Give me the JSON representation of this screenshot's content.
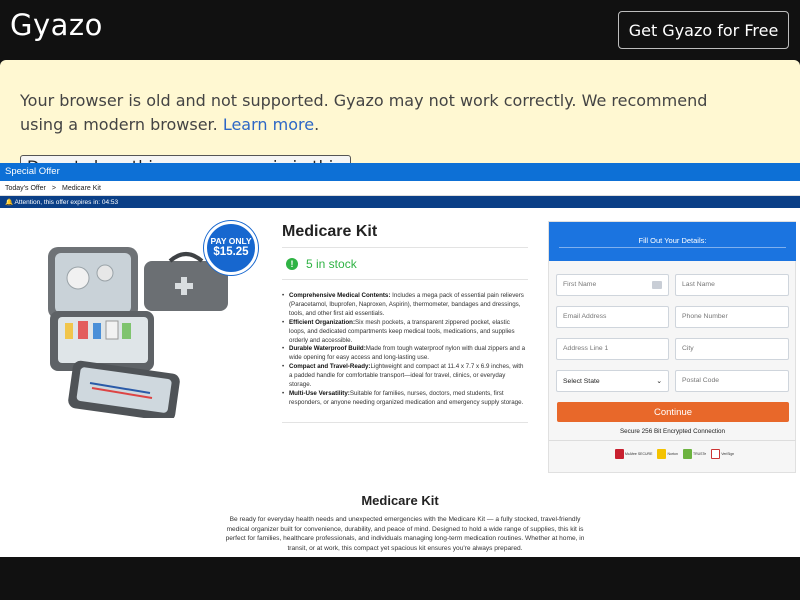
{
  "gyazo": {
    "logo": "Gyazo",
    "cta_label": "Get Gyazo for Free"
  },
  "banner": {
    "message": "Your browser is old and not supported. Gyazo may not work correctly. We recommend using a modern browser.",
    "link_label": "Learn more",
    "trailing": ".",
    "dismiss_label": "Do not show this message again in this browser"
  },
  "page": {
    "offer_bar": "Special Offer",
    "breadcrumb": [
      "Today's Offer",
      "Medicare Kit"
    ],
    "breadcrumb_sep": ">",
    "attention": "Attention, this offer expires in: 04:53",
    "product": {
      "title": "Medicare Kit",
      "stock": "5 in stock",
      "badge_top": "PAY ONLY",
      "badge_price": "$15.25",
      "features": [
        {
          "bold": "Comprehensive Medical Contents:",
          "text": " Includes a mega pack of essential pain relievers (Paracetamol, Ibuprofen, Naproxen, Aspirin), thermometer, bandages and dressings, tools, and other first aid essentials."
        },
        {
          "bold": "Efficient Organization:",
          "text": "Six mesh pockets, a transparent zippered pocket, elastic loops, and dedicated compartments keep medical tools, medications, and supplies orderly and accessible."
        },
        {
          "bold": "Durable Waterproof Build:",
          "text": "Made from tough waterproof nylon with dual zippers and a wide opening for easy access and long-lasting use."
        },
        {
          "bold": "Compact and Travel-Ready:",
          "text": "Lightweight and compact at 11.4 x 7.7 x 6.9 inches, with a padded handle for comfortable transport—ideal for travel, clinics, or everyday storage."
        },
        {
          "bold": "Multi-Use Versatility:",
          "text": "Suitable for families, nurses, doctors, med students, first responders, or anyone needing organized medication and emergency supply storage."
        }
      ]
    },
    "form": {
      "header": "Fill Out Your Details:",
      "first_name": "First Name",
      "last_name": "Last Name",
      "email": "Email Address",
      "phone": "Phone Number",
      "address": "Address Line 1",
      "city": "City",
      "state": "Select State",
      "postal": "Postal Code",
      "continue_label": "Continue",
      "secure_text": "Secure 256 Bit Encrypted Connection",
      "trust_badges": [
        "McAfee SECURE",
        "Norton",
        "TRUSTe",
        "VeriSign"
      ]
    },
    "description": {
      "title": "Medicare Kit",
      "text": "Be ready for everyday health needs and unexpected emergencies with the Medicare Kit — a fully stocked, travel-friendly medical organizer built for convenience, durability, and peace of mind. Designed to hold a wide range of supplies, this kit is perfect for families, healthcare professionals, and individuals managing long-term medication routines. Whether at home, in transit, or at work, this compact yet spacious kit ensures you're always prepared."
    }
  },
  "colors": {
    "gyazo_bg": "#111111",
    "banner_bg": "#fff8d2",
    "link": "#2d67c6",
    "offer_blue": "#0d70d6",
    "attention_navy": "#0a3f87",
    "stock_green": "#2fb344",
    "continue_orange": "#e8682a"
  }
}
